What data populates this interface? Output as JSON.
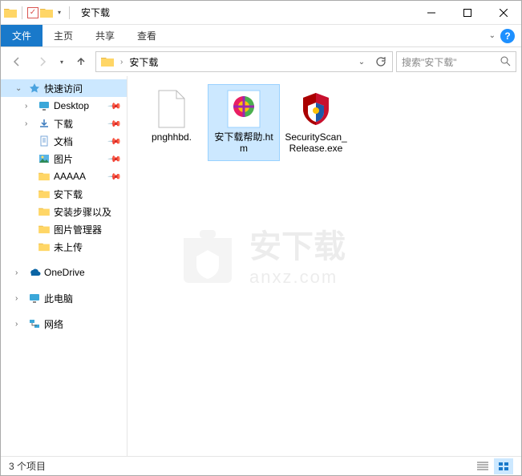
{
  "title": "安下载",
  "ribbon": {
    "file": "文件",
    "tabs": [
      "主页",
      "共享",
      "查看"
    ]
  },
  "address": {
    "path": "安下载",
    "search_placeholder": "搜索\"安下载\""
  },
  "sidebar": {
    "quick_access": "快速访问",
    "items": [
      {
        "name": "Desktop",
        "pinned": true,
        "icon": "desktop"
      },
      {
        "name": "下载",
        "pinned": true,
        "icon": "downloads"
      },
      {
        "name": "文档",
        "pinned": true,
        "icon": "documents"
      },
      {
        "name": "图片",
        "pinned": true,
        "icon": "pictures"
      },
      {
        "name": "AAAAA",
        "pinned": true,
        "icon": "folder"
      },
      {
        "name": "安下载",
        "pinned": false,
        "icon": "folder"
      },
      {
        "name": "安装步骤以及",
        "pinned": false,
        "icon": "folder"
      },
      {
        "name": "图片管理器",
        "pinned": false,
        "icon": "folder"
      },
      {
        "name": "未上传",
        "pinned": false,
        "icon": "folder"
      }
    ],
    "onedrive": "OneDrive",
    "this_pc": "此电脑",
    "network": "网络"
  },
  "files": [
    {
      "name": "pnghhbd.",
      "type": "blank"
    },
    {
      "name": "安下载帮助.htm",
      "type": "htm",
      "selected": true
    },
    {
      "name": "SecurityScan_Release.exe",
      "type": "mcafee"
    }
  ],
  "status": {
    "count_label": "3 个项目"
  },
  "watermark": {
    "cn": "安下载",
    "en": "anxz.com"
  }
}
